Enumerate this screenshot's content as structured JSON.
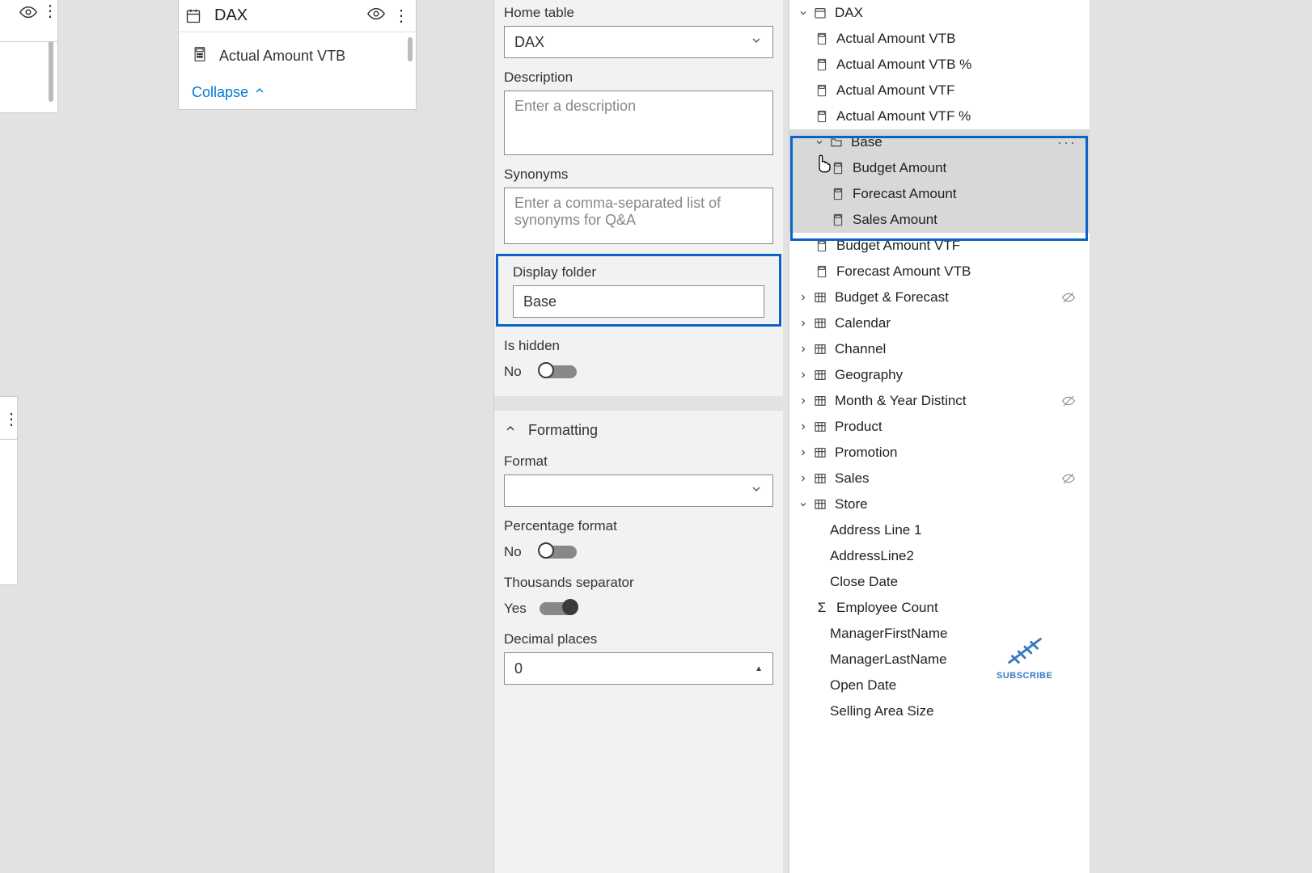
{
  "stray": {},
  "dax_card": {
    "title": "DAX",
    "row1": "Actual Amount VTB",
    "collapse": "Collapse"
  },
  "props": {
    "home_table_label": "Home table",
    "home_table_value": "DAX",
    "description_label": "Description",
    "description_placeholder": "Enter a description",
    "synonyms_label": "Synonyms",
    "synonyms_placeholder": "Enter a comma-separated list of synonyms for Q&A",
    "display_folder_label": "Display folder",
    "display_folder_value": "Base",
    "is_hidden_label": "Is hidden",
    "is_hidden_value": "No",
    "formatting_header": "Formatting",
    "format_label": "Format",
    "format_value": "",
    "pct_label": "Percentage format",
    "pct_value": "No",
    "thousands_label": "Thousands separator",
    "thousands_value": "Yes",
    "decimal_label": "Decimal places",
    "decimal_value": "0"
  },
  "fields": {
    "dax": "DAX",
    "m1": "Actual Amount VTB",
    "m2": "Actual Amount VTB %",
    "m3": "Actual Amount VTF",
    "m4": "Actual Amount VTF %",
    "base": "Base",
    "b1": "Budget Amount",
    "b2": "Forecast Amount",
    "b3": "Sales Amount",
    "m5": "Budget Amount VTF",
    "m6": "Forecast Amount VTB",
    "t1": "Budget & Forecast",
    "t2": "Calendar",
    "t3": "Channel",
    "t4": "Geography",
    "t5": "Month & Year Distinct",
    "t6": "Product",
    "t7": "Promotion",
    "t8": "Sales",
    "t9": "Store",
    "s1": "Address Line 1",
    "s2": "AddressLine2",
    "s3": "Close Date",
    "s4": "Employee Count",
    "s5": "ManagerFirstName",
    "s6": "ManagerLastName",
    "s7": "Open Date",
    "s8": "Selling Area Size"
  },
  "subscribe": {
    "label": "SUBSCRIBE"
  }
}
